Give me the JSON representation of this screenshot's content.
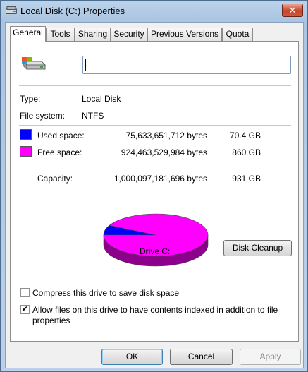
{
  "window": {
    "title": "Local Disk (C:) Properties",
    "close_glyph": "✕"
  },
  "tabs": [
    "General",
    "Tools",
    "Sharing",
    "Security",
    "Previous Versions",
    "Quota"
  ],
  "active_tab": "General",
  "general": {
    "name_value": "",
    "type_label": "Type:",
    "type_value": "Local Disk",
    "fs_label": "File system:",
    "fs_value": "NTFS",
    "used": {
      "label": "Used space:",
      "bytes": "75,633,651,712 bytes",
      "size": "70.4 GB",
      "color": "#0000ff"
    },
    "free": {
      "label": "Free space:",
      "bytes": "924,463,529,984 bytes",
      "size": "860 GB",
      "color": "#ff00ff"
    },
    "capacity": {
      "label": "Capacity:",
      "bytes": "1,000,097,181,696 bytes",
      "size": "931 GB"
    },
    "drive_label": "Drive C:",
    "cleanup_button": "Disk Cleanup",
    "compress_label": "Compress this drive to save disk space",
    "compress_checked": false,
    "index_label_line1": "Allow files on this drive to have contents indexed in addition to file",
    "index_label_line2": "properties",
    "index_checked": true,
    "check_glyph": "✔"
  },
  "buttons": {
    "ok": "OK",
    "cancel": "Cancel",
    "apply": "Apply"
  },
  "chart_data": {
    "type": "pie",
    "categories": [
      "Used space",
      "Free space"
    ],
    "values": [
      75633651712,
      924463529984
    ],
    "colors": [
      "#0000ff",
      "#ff00ff"
    ]
  }
}
